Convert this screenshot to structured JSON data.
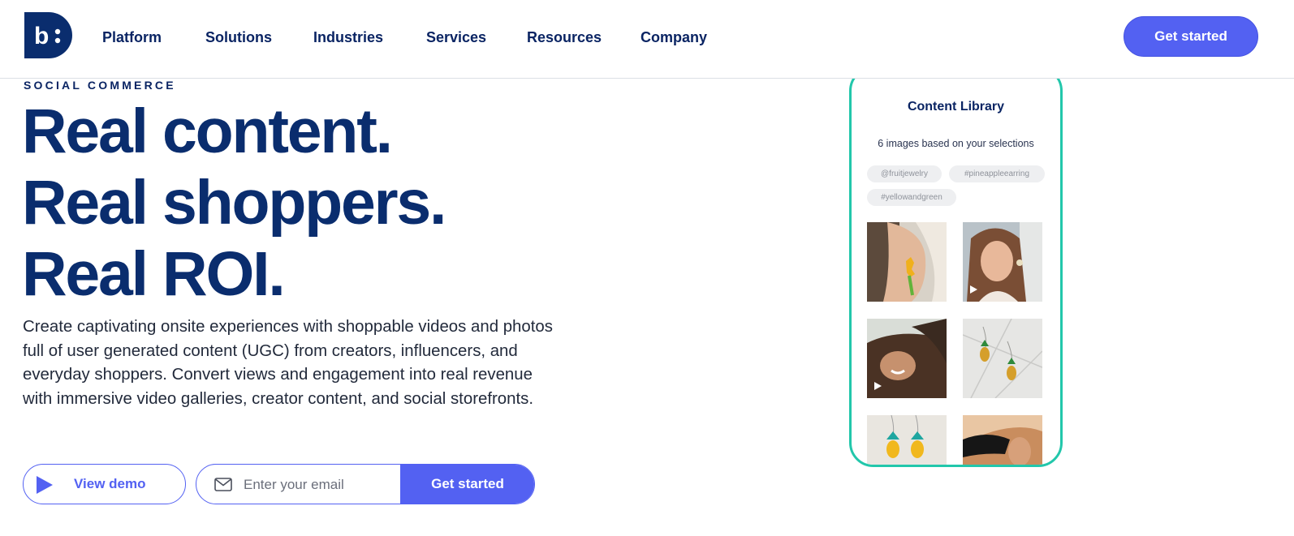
{
  "header": {
    "logo_alt": "b:",
    "nav": [
      "Platform",
      "Solutions",
      "Industries",
      "Services",
      "Resources",
      "Company"
    ],
    "cta_label": "Get started"
  },
  "hero": {
    "eyebrow": "SOCIAL COMMERCE",
    "headline": [
      "Real content.",
      "Real shoppers.",
      "Real ROI."
    ],
    "description": "Create captivating onsite experiences with shoppable videos and photos full of user generated content (UGC) from creators, influencers, and everyday shoppers. Convert views and engagement into real revenue with immersive video galleries, creator content, and social storefronts.",
    "demo_label": "View demo",
    "email_placeholder": "Enter your email",
    "submit_label": "Get started"
  },
  "phone": {
    "title": "Content Library",
    "subtitle": "6 images based on your selections",
    "tags": [
      "@fruitjewelry",
      "#pineappleearring",
      "#yellowandgreen"
    ]
  },
  "colors": {
    "brand_navy": "#0a2d6e",
    "accent": "#5361f2",
    "teal": "#22c7ab"
  }
}
